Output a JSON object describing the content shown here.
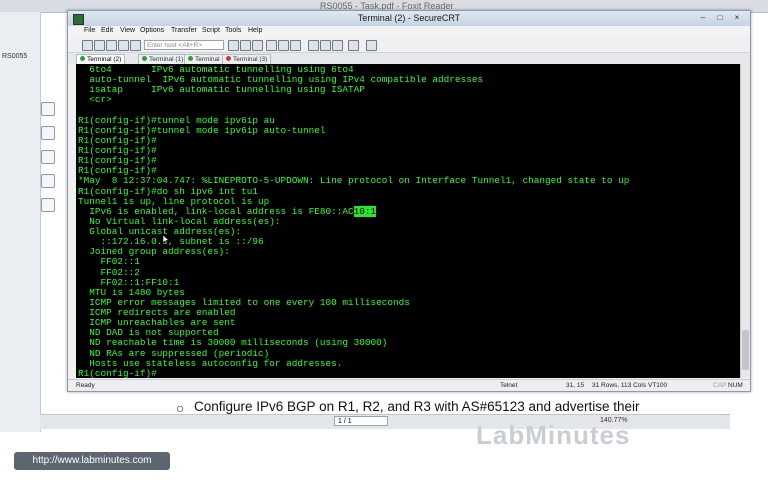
{
  "background": {
    "reader_title": "RS0055 - Task.pdf - Foxit Reader",
    "sidebar_label": "RS0055",
    "bullet_text": "Configure IPv6 BGP on R1, R2, and R3 with AS#65123 and advertise their",
    "page_field": "1 / 1",
    "zoom": "140.77%",
    "logo_text": "LabMinutes",
    "url": "http://www.labminutes.com"
  },
  "window": {
    "title": "Terminal (2) - SecureCRT",
    "menu": [
      "File",
      "Edit",
      "View",
      "Options",
      "Transfer",
      "Script",
      "Tools",
      "Help"
    ],
    "host_placeholder": "Enter host <Alt+R>",
    "tabs": [
      "Terminal (2)",
      "Terminal (1)",
      "Terminal",
      "Terminal (3)"
    ]
  },
  "terminal": {
    "lines": [
      "  6to4       IPv6 automatic tunnelling using 6to4",
      "  auto-tunnel  IPv6 automatic tunnelling using IPv4 compatible addresses",
      "  isatap     IPv6 automatic tunnelling using ISATAP",
      "  <cr>",
      "",
      "R1(config-if)#tunnel mode ipv6ip au",
      "R1(config-if)#tunnel mode ipv6ip auto-tunnel",
      "R1(config-if)#",
      "R1(config-if)#",
      "R1(config-if)#",
      "R1(config-if)#",
      "*May  8 12:37:04.747: %LINEPROTO-5-UPDOWN: Line protocol on Interface Tunnel1, changed state to up",
      "R1(config-if)#do sh ipv6 int tu1",
      "Tunnel1 is up, line protocol is up",
      "  IPv6 is enabled, link-local address is FE80::AC",
      "  No Virtual link-local address(es):",
      "  Global unicast address(es):",
      "    ::172.16.0.1, subnet is ::/96",
      "  Joined group address(es):",
      "    FF02::1",
      "    FF02::2",
      "    FF02::1:FF10:1",
      "  MTU is 1480 bytes",
      "  ICMP error messages limited to one every 100 milliseconds",
      "  ICMP redirects are enabled",
      "  ICMP unreachables are sent",
      "  ND DAD is not supported",
      "  ND reachable time is 30000 milliseconds (using 30000)",
      "  ND RAs are suppressed (periodic)",
      "  Hosts use stateless autoconfig for addresses.",
      "R1(config-if)#"
    ],
    "selected_text": "10:1"
  },
  "status": {
    "ready": "Ready",
    "protocol": "Telnet",
    "position": "31, 15",
    "size": "31 Rows, 113 Cols",
    "emulation": "VT100",
    "caps": "CAP",
    "num": "NUM"
  },
  "colors": {
    "terminal_fg": "#2bff2b",
    "terminal_bg": "#000000",
    "selection_bg": "#28e628"
  }
}
